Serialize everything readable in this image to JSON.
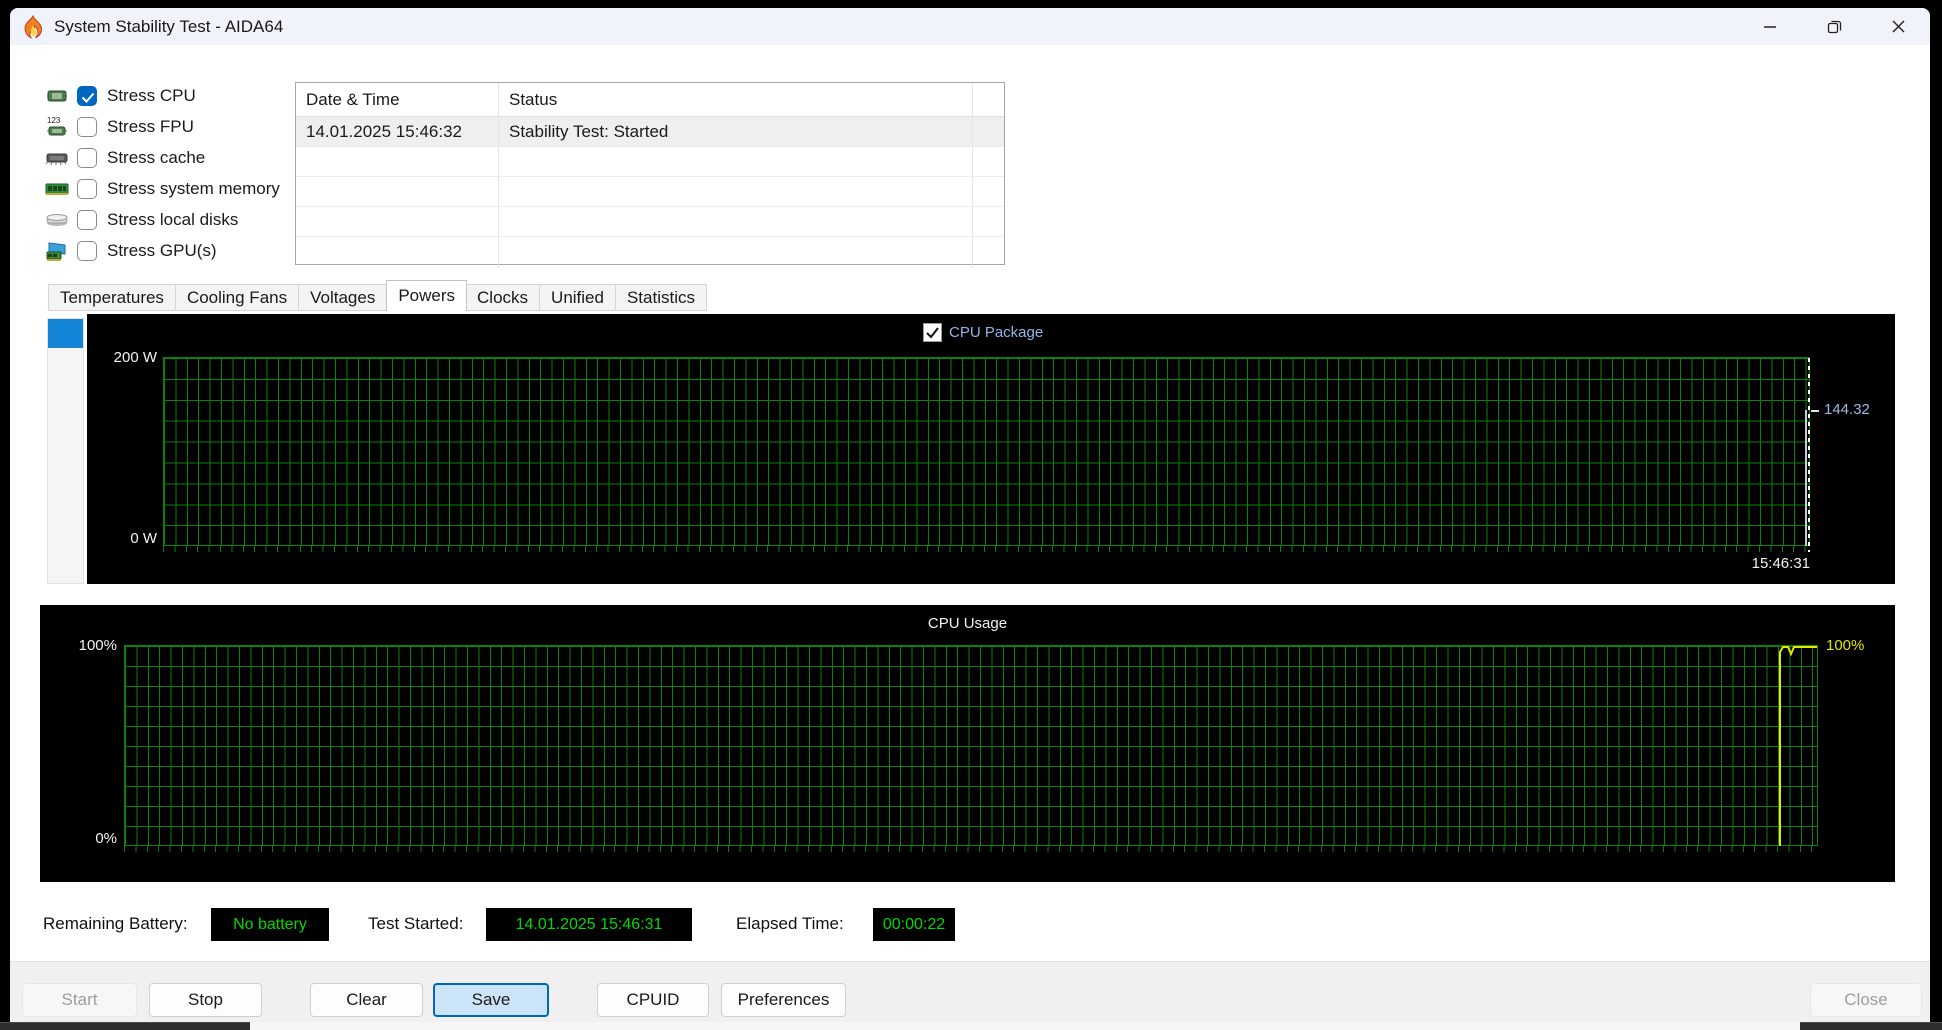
{
  "window": {
    "title": "System Stability Test - AIDA64",
    "controls": {
      "minimize": "minimize",
      "restore": "restore",
      "close": "close"
    }
  },
  "stress_options": [
    {
      "label": "Stress CPU",
      "checked": true,
      "icon": "cpu-chip-icon"
    },
    {
      "label": "Stress FPU",
      "checked": false,
      "icon": "fpu-123-chip-icon"
    },
    {
      "label": "Stress cache",
      "checked": false,
      "icon": "cache-chip-icon"
    },
    {
      "label": "Stress system memory",
      "checked": false,
      "icon": "memory-module-icon"
    },
    {
      "label": "Stress local disks",
      "checked": false,
      "icon": "hard-disk-icon"
    },
    {
      "label": "Stress GPU(s)",
      "checked": false,
      "icon": "gpu-card-icon"
    }
  ],
  "log_table": {
    "columns": [
      "Date & Time",
      "Status"
    ],
    "rows": [
      [
        "14.01.2025 15:46:32",
        "Stability Test: Started"
      ]
    ]
  },
  "tabs": {
    "items": [
      "Temperatures",
      "Cooling Fans",
      "Voltages",
      "Powers",
      "Clocks",
      "Unified",
      "Statistics"
    ],
    "selected": "Powers"
  },
  "power_chart": {
    "series_label": "CPU Package",
    "series_checked": true,
    "y_max_label": "200 W",
    "y_min_label": "0 W",
    "current_value": "144.32",
    "timestamp": "15:46:31"
  },
  "usage_chart": {
    "title": "CPU Usage",
    "y_max_label": "100%",
    "y_min_label": "0%",
    "current_value_label": "100%"
  },
  "status_bar": {
    "battery_label": "Remaining Battery:",
    "battery_value": "No battery",
    "started_label": "Test Started:",
    "started_value": "14.01.2025 15:46:31",
    "elapsed_label": "Elapsed Time:",
    "elapsed_value": "00:00:22"
  },
  "buttons": {
    "start": "Start",
    "stop": "Stop",
    "clear": "Clear",
    "save": "Save",
    "cpuid": "CPUID",
    "preferences": "Preferences",
    "close": "Close"
  },
  "colors": {
    "accent_blue": "#0067c0",
    "grid_green": "#0a820a",
    "trace_yellow": "#e6e600",
    "status_green": "#00d900",
    "value_label_blue": "#9cb9e3",
    "panel_black": "#000000"
  },
  "chart_data": [
    {
      "type": "line",
      "title": "CPU Package power",
      "ylabel": "Watts",
      "ylim": [
        0,
        200
      ],
      "x_end_time": "15:46:31",
      "series": [
        {
          "name": "CPU Package",
          "current_value": 144.32,
          "values": [
            0,
            144.32
          ]
        }
      ],
      "grid": true,
      "legend_position": "top-center"
    },
    {
      "type": "line",
      "title": "CPU Usage",
      "ylabel": "Percent",
      "ylim": [
        0,
        100
      ],
      "series": [
        {
          "name": "CPU Usage",
          "current_value": 100,
          "values": [
            0,
            100,
            97,
            100,
            100
          ]
        }
      ],
      "grid": true
    }
  ]
}
